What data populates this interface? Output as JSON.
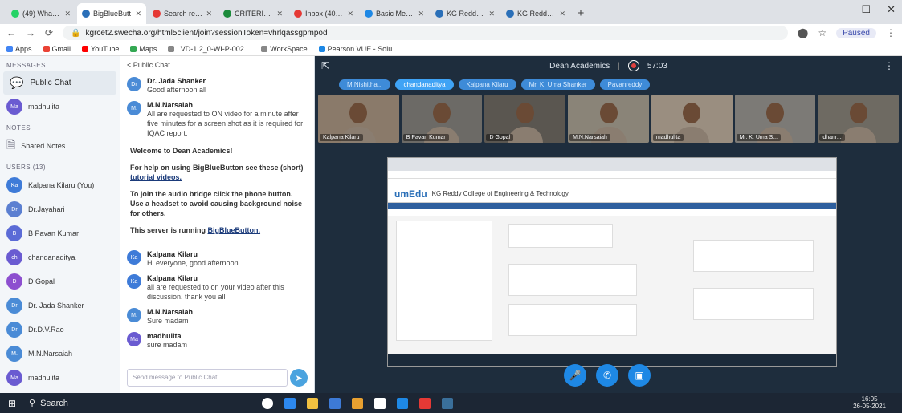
{
  "browser": {
    "tabs": [
      {
        "label": "(49) WhatsApp",
        "color": "#25d366"
      },
      {
        "label": "BigBlueButt",
        "color": "#2a6fb8",
        "active": true
      },
      {
        "label": "Search results",
        "color": "#e53935"
      },
      {
        "label": "CRITERION III",
        "color": "#1b8a3a"
      },
      {
        "label": "Inbox (400) - kri",
        "color": "#e53935"
      },
      {
        "label": "Basic Mechanics",
        "color": "#1e88e5"
      },
      {
        "label": "KG Reddy Colleg",
        "color": "#2a6fb8"
      },
      {
        "label": "KG Reddy Colleg",
        "color": "#2a6fb8"
      }
    ],
    "url": "kgrcet2.swecha.org/html5client/join?sessionToken=vhrlqassgpmpod",
    "profile_label": "Paused",
    "bookmarks": [
      {
        "label": "Apps",
        "color": "#4285f4"
      },
      {
        "label": "Gmail",
        "color": "#ea4335"
      },
      {
        "label": "YouTube",
        "color": "#ff0000"
      },
      {
        "label": "Maps",
        "color": "#34a853"
      },
      {
        "label": "LVD-1.2_0-WI-P-002...",
        "color": "#888888"
      },
      {
        "label": "WorkSpace",
        "color": "#888888"
      },
      {
        "label": "Pearson VUE - Solu...",
        "color": "#1e88e5"
      }
    ]
  },
  "sidebar": {
    "messages_title": "MESSAGES",
    "public_chat": "Public Chat",
    "private_chat": {
      "initials": "Ma",
      "name": "madhulita"
    },
    "notes_title": "NOTES",
    "shared_notes": "Shared Notes",
    "users_title": "USERS (13)",
    "users": [
      {
        "initials": "Ka",
        "name": "Kalpana Kilaru (You)",
        "color": "#3e7bd8"
      },
      {
        "initials": "Dr",
        "name": "Dr.Jayahari",
        "color": "#5b7fd1"
      },
      {
        "initials": "B",
        "name": "B Pavan Kumar",
        "color": "#5b6bd6"
      },
      {
        "initials": "ch",
        "name": "chandanaditya",
        "color": "#6a5bd1"
      },
      {
        "initials": "D",
        "name": "D Gopal",
        "color": "#8d4fcf"
      },
      {
        "initials": "Dr",
        "name": "Dr. Jada Shanker",
        "color": "#4a8bd6"
      },
      {
        "initials": "Dr",
        "name": "Dr.D.V.Rao",
        "color": "#4a8bd6"
      },
      {
        "initials": "M.",
        "name": "M.N.Narsaiah",
        "color": "#4a8bd6"
      },
      {
        "initials": "Ma",
        "name": "madhulita",
        "color": "#6a5bd1"
      }
    ]
  },
  "chat": {
    "back_label": "< Public Chat",
    "messages": [
      {
        "initials": "Dr",
        "name": "Dr. Jada Shanker",
        "time": "",
        "text": "Good afternoon all",
        "color": "#4a8bd6"
      },
      {
        "initials": "M.",
        "name": "M.N.Narsaiah",
        "time": "",
        "text": "All are requested to ON video for a minute after five minutes for a screen shot as it is required for IQAC report.",
        "color": "#4a8bd6"
      }
    ],
    "welcome": {
      "title": "Welcome to Dean Academics!",
      "help_prefix": "For help on using BigBlueButton see these (short) ",
      "help_link": "tutorial videos.",
      "audio": "To join the audio bridge click the phone button. Use a headset to avoid causing background noise for others.",
      "server_prefix": "This server is running ",
      "server_link": "BigBlueButton."
    },
    "messages2": [
      {
        "initials": "Ka",
        "name": "Kalpana Kilaru",
        "time": "",
        "text": "Hi everyone, good afternoon",
        "color": "#3e7bd8"
      },
      {
        "initials": "Ka",
        "name": "Kalpana Kilaru",
        "time": "",
        "text": "all are requested to on your video after this discussion. thank you all",
        "color": "#3e7bd8"
      },
      {
        "initials": "M.",
        "name": "M.N.Narsaiah",
        "time": "",
        "text": "Sure madam",
        "color": "#4a8bd6"
      },
      {
        "initials": "Ma",
        "name": "madhulita",
        "time": "",
        "text": "sure madam",
        "color": "#6a5bd1"
      }
    ],
    "input_placeholder": "Send message to Public Chat"
  },
  "meeting": {
    "title": "Dean Academics",
    "timer": "57:03",
    "talkers": [
      "M.Nishitha...",
      "chandanaditya",
      "Kalpana Kilaru",
      "Mr. K. Uma Shanker",
      "Pavanreddy"
    ],
    "tiles": [
      "Kalpana Kilaru",
      "B Pavan Kumar",
      "D Gopal",
      "M.N.Narsaiah",
      "madhulita",
      "Mr. K. Uma S...",
      "dhanr..."
    ],
    "shared": {
      "brand": "umEdu",
      "college": "KG Reddy College of Engineering & Technology"
    }
  },
  "taskbar": {
    "search_label": "Search",
    "time": "16:05",
    "date": "26-05-2021"
  }
}
